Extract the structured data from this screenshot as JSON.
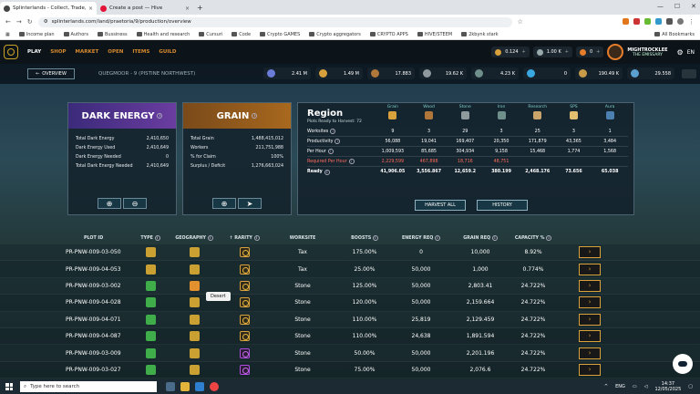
{
  "browser": {
    "tabs": [
      {
        "label": "Splinterlands - Collect, Trade, B",
        "active": true
      },
      {
        "label": "Create a post — Hive",
        "active": false
      }
    ],
    "url": "splinterlands.com/land/praetoria/9/production/overview",
    "bookmarks": [
      "Income plan",
      "Authors",
      "Bussiness",
      "Health and research",
      "Cursuri",
      "Code",
      "Crypto GAMES",
      "Crypto aggregators",
      "CRYPTO APPS",
      "HIVE/STEEM",
      "2kbynk stark"
    ],
    "all_bookmarks": "All Bookmarks"
  },
  "nav": {
    "items": [
      "PLAY",
      "SHOP",
      "MARKET",
      "OPEN",
      "ITEMS",
      "GUILD"
    ],
    "balances": [
      "0.124",
      "1.00 K",
      "0"
    ],
    "user_name": "MIGHTROCKLEE",
    "user_title": "THE EMISSARY",
    "language": "EN"
  },
  "subnav": {
    "overview_label": "OVERVIEW",
    "location": "QUEGMOOR - 9 (PISTINE NORTHWEST)",
    "resources": [
      {
        "name": "dec",
        "value": "2.41 M",
        "color": "#6a7bd8"
      },
      {
        "name": "grain",
        "value": "1.49 M",
        "color": "#d9a13b"
      },
      {
        "name": "wood",
        "value": "17.883",
        "color": "#b0773a"
      },
      {
        "name": "stone",
        "value": "19.62 K",
        "color": "#8f9a9f"
      },
      {
        "name": "iron",
        "value": "4.23 K",
        "color": "#6f8f8a"
      },
      {
        "name": "research",
        "value": "0",
        "color": "#3aa7e0"
      },
      {
        "name": "sps",
        "value": "190.49 K",
        "color": "#c79b47"
      },
      {
        "name": "aura",
        "value": "29.558",
        "color": "#5aa0d0"
      }
    ]
  },
  "dark_energy": {
    "title": "DARK ENERGY",
    "rows": [
      {
        "label": "Total Dark Energy",
        "value": "2,410,650"
      },
      {
        "label": "Dark Energy Used",
        "value": "2,410,649"
      },
      {
        "label": "Dark Energy Needed",
        "value": "0"
      },
      {
        "label": "Total Dark Energy Needed",
        "value": "2,410,649"
      }
    ]
  },
  "grain": {
    "title": "GRAIN",
    "rows": [
      {
        "label": "Total Grain",
        "value": "1,488,415,012"
      },
      {
        "label": "Workers",
        "value": "211,751,988"
      },
      {
        "label": "% for Claim",
        "value": "100%"
      },
      {
        "label": "Surplus / Deficit",
        "value": "1,276,663,024"
      }
    ]
  },
  "region": {
    "title": "Region",
    "subtitle": "Plots Ready to Harvest: 72",
    "columns": [
      {
        "label": "Grain",
        "color": "#d9a13b"
      },
      {
        "label": "Wood",
        "color": "#b0773a"
      },
      {
        "label": "Stone",
        "color": "#8f9a9f"
      },
      {
        "label": "Iron",
        "color": "#6f8f8a"
      },
      {
        "label": "Research",
        "color": "#c9a46b"
      },
      {
        "label": "SPS",
        "color": "#e0c070"
      },
      {
        "label": "Aura",
        "color": "#4c80b0"
      }
    ],
    "rows": [
      {
        "label": "Worksites",
        "values": [
          "9",
          "3",
          "29",
          "3",
          "25",
          "3",
          "1"
        ],
        "style": ""
      },
      {
        "label": "Productivity",
        "values": [
          "56,088",
          "19,041",
          "169,407",
          "20,350",
          "171,879",
          "43,365",
          "3,484"
        ],
        "style": ""
      },
      {
        "label": "Per Hour",
        "values": [
          "1,009,593",
          "85,685",
          "304,934",
          "9,158",
          "15,468",
          "1,774",
          "1,568"
        ],
        "style": ""
      },
      {
        "label": "Required Per Hour",
        "values": [
          "2,229,599",
          "467,898",
          "18,716",
          "48,751",
          "",
          "",
          ""
        ],
        "style": "red"
      },
      {
        "label": "Ready",
        "values": [
          "41,906.05",
          "3,556.867",
          "12,659.2",
          "380.199",
          "2,468.176",
          "73.656",
          "65.038"
        ],
        "style": "bold"
      }
    ],
    "harvest_label": "HARVEST ALL",
    "history_label": "HISTORY"
  },
  "plots": {
    "headers": [
      "PLOT ID",
      "TYPE",
      "GEOGRAPHY",
      "RARITY",
      "WORKSITE",
      "BOOSTS",
      "ENERGY REQ",
      "GRAIN REQ",
      "CAPACITY %"
    ],
    "rows": [
      {
        "id": "PR-PNW-009-03-050",
        "type": "yellow",
        "geo": "yellow",
        "rarity": "gold",
        "worksite": "Tax",
        "boosts": "175.00%",
        "energy": "0",
        "grain": "10,000",
        "capacity": "8.92%"
      },
      {
        "id": "PR-PNW-009-04-053",
        "type": "yellow",
        "geo": "yellow",
        "rarity": "gold",
        "worksite": "Tax",
        "boosts": "25.00%",
        "energy": "50,000",
        "grain": "1,000",
        "capacity": "0.774%"
      },
      {
        "id": "PR-PNW-009-03-002",
        "type": "green",
        "geo": "orange",
        "rarity": "gold",
        "worksite": "Stone",
        "boosts": "125.00%",
        "energy": "50,000",
        "grain": "2,803.41",
        "capacity": "24.722%"
      },
      {
        "id": "PR-PNW-009-04-028",
        "type": "green",
        "geo": "yellow",
        "rarity": "gold",
        "worksite": "Stone",
        "boosts": "120.00%",
        "energy": "50,000",
        "grain": "2,159.664",
        "capacity": "24.722%"
      },
      {
        "id": "PR-PNW-009-04-071",
        "type": "green",
        "geo": "yellow",
        "rarity": "gold",
        "worksite": "Stone",
        "boosts": "110.00%",
        "energy": "25,819",
        "grain": "2,129.459",
        "capacity": "24.722%"
      },
      {
        "id": "PR-PNW-009-04-087",
        "type": "green",
        "geo": "yellow",
        "rarity": "gold",
        "worksite": "Stone",
        "boosts": "110.00%",
        "energy": "24,638",
        "grain": "1,891.594",
        "capacity": "24.722%"
      },
      {
        "id": "PR-PNW-009-03-009",
        "type": "green",
        "geo": "yellow",
        "rarity": "purple",
        "worksite": "Stone",
        "boosts": "50.00%",
        "energy": "50,000",
        "grain": "2,201.196",
        "capacity": "24.722%"
      },
      {
        "id": "PR-PNW-009-03-027",
        "type": "green",
        "geo": "yellow",
        "rarity": "purple",
        "worksite": "Stone",
        "boosts": "75.00%",
        "energy": "50,000",
        "grain": "2,076.6",
        "capacity": "24.722%"
      }
    ],
    "tooltip": "Desert"
  },
  "taskbar": {
    "search_placeholder": "Type here to search",
    "lang": "ENG",
    "time": "14:37",
    "date": "12/05/2025"
  }
}
